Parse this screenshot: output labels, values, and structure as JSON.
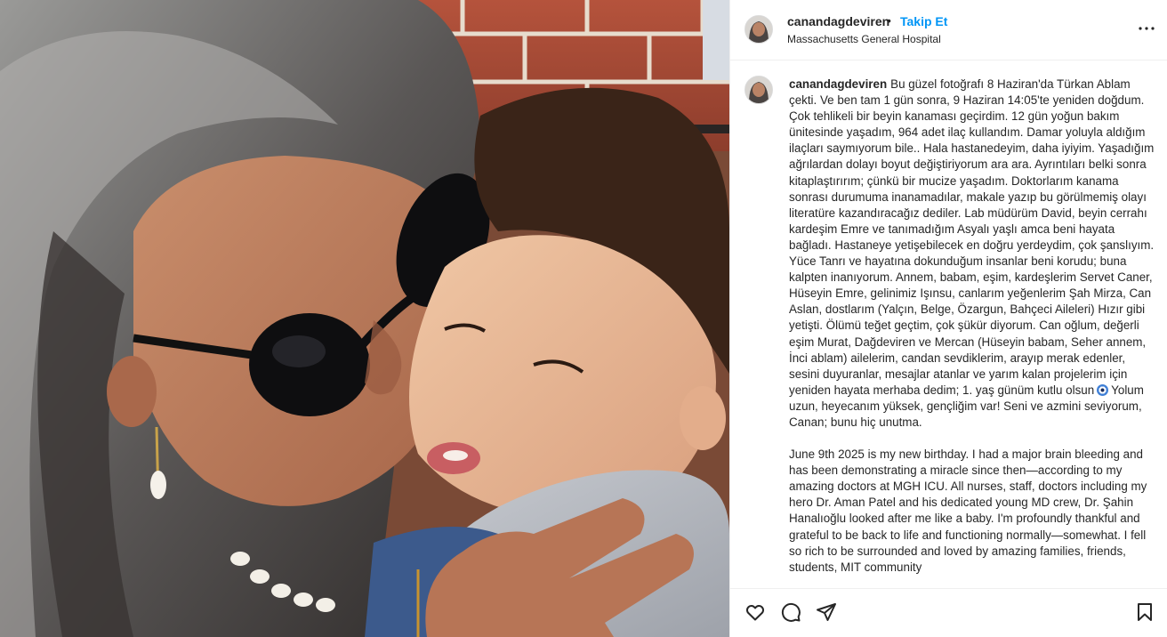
{
  "header": {
    "username": "canandagdeviren",
    "separator": "•",
    "follow_label": "Takip Et",
    "location": "Massachusetts General Hospital",
    "more_icon": "more-horizontal-icon"
  },
  "caption": {
    "username": "canandagdeviren",
    "paragraph1_part1": "Bu güzel fotoğrafı 8 Haziran'da Türkan Ablam çekti. Ve ben tam 1 gün sonra, 9 Haziran 14:05'te yeniden doğdum. Çok tehlikeli bir beyin kanaması geçirdim. 12 gün yoğun bakım ünitesinde yaşadım, 964 adet ilaç kullandım. Damar yoluyla aldığım ilaçları saymıyorum bile.. Hala hastanedeyim, daha iyiyim. Yaşadığım ağrılardan dolayı boyut değiştiriyorum ara ara. Ayrıntıları belki sonra kitaplaştırırım; çünkü bir mucize yaşadım. Doktorlarım kanama sonrası durumuma inanamadılar, makale yazıp bu görülmemiş olayı literatüre kazandıracağız dediler. Lab müdürüm David, beyin cerrahı kardeşim Emre ve tanımadığım Asyalı yaşlı amca beni hayata bağladı. Hastaneye yetişebilecek en doğru yerdeydim, çok şanslıyım. Yüce Tanrı ve hayatına dokunduğum insanlar beni korudu; buna kalpten inanıyorum. Annem, babam, eşim, kardeşlerim Servet Caner, Hüseyin Emre, gelinimiz Işınsu, canlarım yeğenlerim Şah Mirza, Can Aslan, dostlarım (Yalçın, Belge, Özargun, Bahçeci Aileleri) Hızır gibi yetişti. Ölümü teğet geçtim, çok şükür diyorum. Can oğlum, değerli eşim Murat, Dağdeviren ve Mercan (Hüseyin babam, Seher annem, İnci ablam) ailelerim, candan sevdiklerim, arayıp merak edenler, sesini duyuranlar, mesajlar atanlar ve yarım kalan projelerim için yeniden hayata merhaba dedim; 1. yaş günüm kutlu olsun",
    "emoji_icon": "nazar-eye-emoji-icon",
    "paragraph1_part2": "Yolum uzun, heyecanım yüksek, gençliğim var! Seni ve azmini seviyorum, Canan; bunu hiç unutma.",
    "paragraph2": "June 9th 2025 is my new birthday. I had a major brain bleeding and has been demonstrating a miracle since then—according to my amazing doctors at MGH ICU. All nurses, staff, doctors including my hero Dr. Aman Patel and his dedicated young MD crew, Dr. Şahin Hanalıoğlu looked after me like a baby. I'm profoundly thankful and grateful to be back to life and functioning normally—somewhat. I fell so rich to be surrounded and loved by amazing families, friends, students, MIT community"
  },
  "actions": {
    "like_icon": "heart-icon",
    "comment_icon": "comment-icon",
    "share_icon": "share-icon",
    "save_icon": "bookmark-icon"
  },
  "photo": {
    "description_icon": "post-photo"
  }
}
